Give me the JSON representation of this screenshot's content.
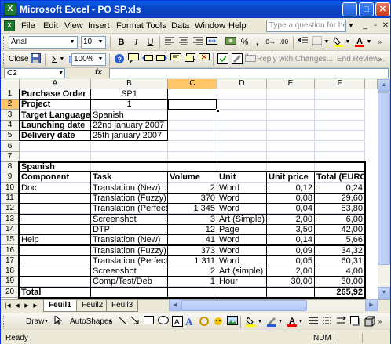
{
  "window": {
    "title": "Microsoft Excel - PO SP.xls",
    "minimize": "_",
    "maximize": "□",
    "close": "✕"
  },
  "menu": {
    "items": [
      "File",
      "Edit",
      "View",
      "Insert",
      "Format",
      "Tools",
      "Data",
      "Window",
      "Help"
    ],
    "ask_placeholder": "Type a question for help",
    "doc_minimize": "_",
    "doc_restore": "▫",
    "doc_close": "✕"
  },
  "toolbar_format": {
    "font": "Arial",
    "size": "10",
    "bold": "B",
    "italic": "I",
    "underline": "U",
    "percent": "%",
    "comma": ","
  },
  "toolbar_standard": {
    "close": "Close",
    "zoom": "100%",
    "reply": "Reply with Changes...",
    "end_review": "End Review..."
  },
  "formula_bar": {
    "name_box": "C2",
    "fx": "fx",
    "content": ""
  },
  "grid": {
    "columns": [
      "A",
      "B",
      "C",
      "D",
      "E",
      "F"
    ],
    "rows": [
      "1",
      "2",
      "3",
      "4",
      "5",
      "6",
      "7",
      "8",
      "9",
      "10",
      "11",
      "12",
      "13",
      "14",
      "15",
      "16",
      "17",
      "18",
      "19",
      "20"
    ],
    "selected_cell": "C2",
    "header": {
      "purchase_order_label": "Purchase Order",
      "purchase_order_value": "SP1",
      "project_label": "Project",
      "project_value": "1",
      "target_language_label": "Target Language",
      "target_language_value": "Spanish",
      "launching_date_label": "Launching date",
      "launching_date_value": "22nd january 2007",
      "delivery_date_label": "Delivery date",
      "delivery_date_value": "25th january 2007"
    },
    "table": {
      "section": "Spanish",
      "headers": [
        "Component",
        "Task",
        "Volume",
        "Unit",
        "Unit price",
        "Total (EURO)"
      ],
      "rows": [
        [
          "Doc",
          "Translation (New)",
          "2",
          "Word",
          "0,12",
          "0,24"
        ],
        [
          "",
          "Translation (Fuzzy)",
          "370",
          "Word",
          "0,08",
          "29,60"
        ],
        [
          "",
          "Translation (Perfect)",
          "1 345",
          "Word",
          "0,04",
          "53,80"
        ],
        [
          "",
          "Screenshot",
          "3",
          "Art (Simple)",
          "2,00",
          "6,00"
        ],
        [
          "",
          "DTP",
          "12",
          "Page",
          "3,50",
          "42,00"
        ],
        [
          "Help",
          "Translation (New)",
          "41",
          "Word",
          "0,14",
          "5,66"
        ],
        [
          "",
          "Translation (Fuzzy)",
          "373",
          "Word",
          "0,09",
          "34,32"
        ],
        [
          "",
          "Translation (Perfect)",
          "1 311",
          "Word",
          "0,05",
          "60,31"
        ],
        [
          "",
          "Screenshot",
          "2",
          "Art (simple)",
          "2,00",
          "4,00"
        ],
        [
          "",
          "Comp/Test/Deb",
          "1",
          "Hour",
          "30,00",
          "30,00"
        ]
      ],
      "total_label": "Total",
      "total_value": "265,92"
    }
  },
  "sheets": {
    "tabs": [
      "Feuil1",
      "Feuil2",
      "Feuil3"
    ],
    "active": "Feuil1"
  },
  "drawing": {
    "draw": "Draw",
    "autoshapes": "AutoShapes"
  },
  "status": {
    "text": "Ready",
    "num": "NUM"
  }
}
